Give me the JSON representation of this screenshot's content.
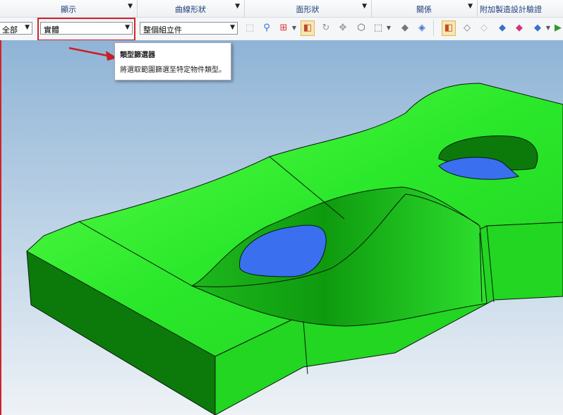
{
  "ribbon": {
    "groups": [
      {
        "label": "顯示"
      },
      {
        "label": "曲線形狀"
      },
      {
        "label": "面形狀"
      },
      {
        "label": "關係"
      },
      {
        "label": "附加製造設計驗證"
      }
    ],
    "display_select": {
      "value": "全部"
    },
    "type_filter_select": {
      "value": "實體"
    },
    "scope_select": {
      "value": "整個組立件"
    }
  },
  "tooltip": {
    "title": "類型篩選器",
    "description": "將選取範圍篩選至特定物件類型。"
  },
  "colors": {
    "highlight_box": "#d0232a",
    "annotation_arrow": "#c81e26",
    "solid_body": "#2be82b",
    "selected_face": "#3a6ff0",
    "viewport_top": "#8fb4d6",
    "viewport_bottom": "#eef2f6"
  },
  "icons": [
    "select-body-icon",
    "filter-icon",
    "snap-point-icon",
    "solid-view-icon",
    "rotate-icon",
    "move-icon",
    "transform-icon",
    "polygon-select-icon",
    "box-select-icon",
    "shaded-view-icon",
    "cube-view-icon",
    "render-mode-icon",
    "wireframe-icon",
    "hidden-line-icon",
    "edges-icon",
    "color-cube-icon",
    "view-cube-icon",
    "run-icon"
  ]
}
